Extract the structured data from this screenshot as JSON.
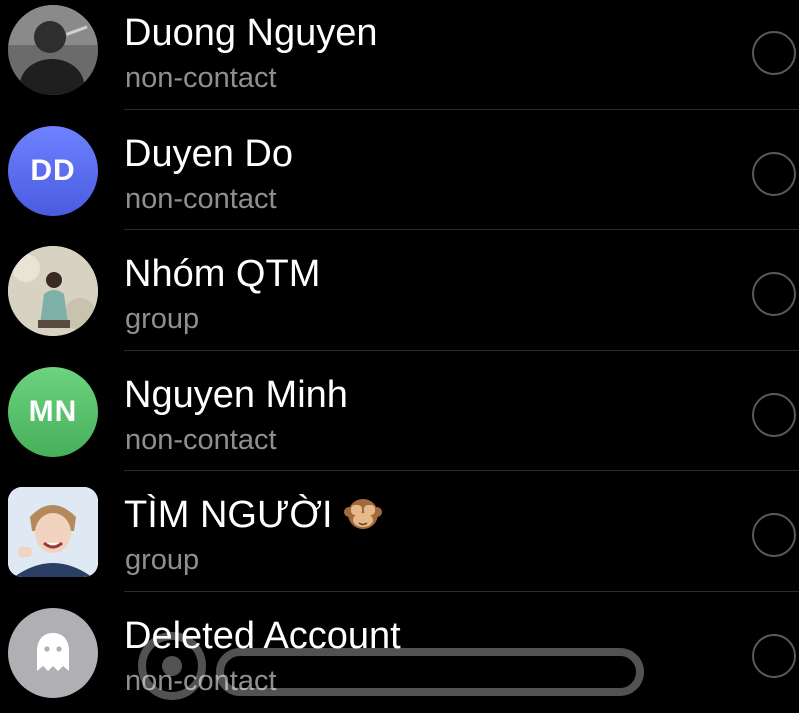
{
  "contacts": [
    {
      "name": "Duong Nguyen",
      "subtitle": "non-contact",
      "avatar": {
        "type": "photo",
        "icon": "person-photo"
      }
    },
    {
      "name": "Duyen Do",
      "subtitle": "non-contact",
      "avatar": {
        "type": "initials",
        "initials": "DD",
        "color": "#5b6ef2"
      }
    },
    {
      "name": "Nhóm QTM",
      "subtitle": "group",
      "avatar": {
        "type": "photo",
        "icon": "group-photo"
      }
    },
    {
      "name": "Nguyen Minh",
      "subtitle": "non-contact",
      "avatar": {
        "type": "initials",
        "initials": "MN",
        "color": "#56c16a"
      }
    },
    {
      "name": "TÌM NGƯỜI",
      "subtitle": "group",
      "emoji": "see-no-evil-monkey-icon",
      "avatar": {
        "type": "photo",
        "icon": "person-photo"
      }
    },
    {
      "name": "Deleted Account",
      "subtitle": "non-contact",
      "avatar": {
        "type": "icon",
        "icon": "ghost-icon",
        "color": "#b0b0b4"
      }
    }
  ],
  "colors": {
    "background": "#000000",
    "name": "#ffffff",
    "subtitle": "#8e8e93",
    "radio_border": "#5a5a5e",
    "divider": "#2b2b2e"
  }
}
